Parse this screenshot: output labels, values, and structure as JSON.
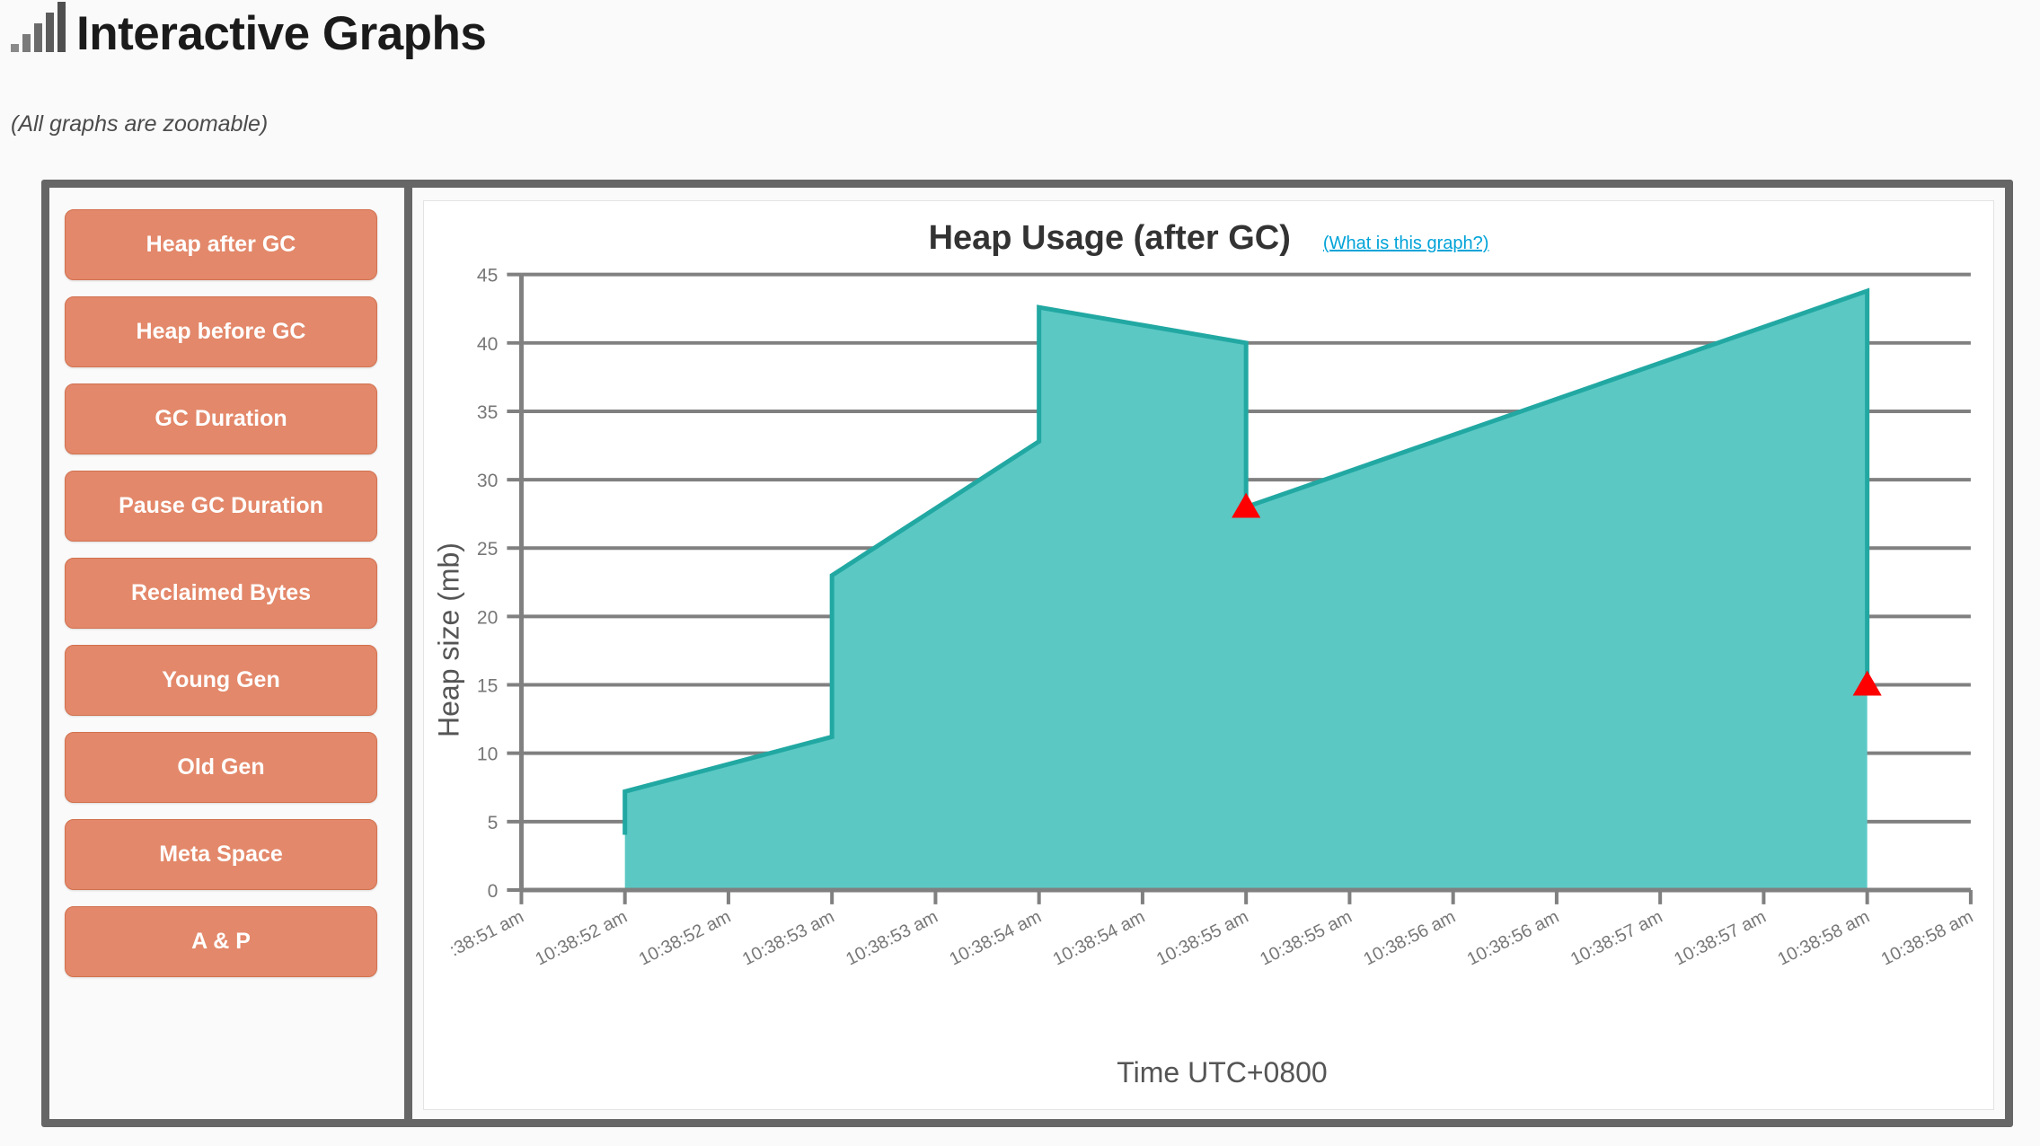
{
  "header": {
    "title": "Interactive Graphs",
    "subtitle": "(All graphs are zoomable)",
    "icon": "bar-chart-icon"
  },
  "sidebar": {
    "items": [
      {
        "label": "Heap after GC"
      },
      {
        "label": "Heap before GC"
      },
      {
        "label": "GC Duration"
      },
      {
        "label": "Pause GC Duration"
      },
      {
        "label": "Reclaimed Bytes"
      },
      {
        "label": "Young Gen"
      },
      {
        "label": "Old Gen"
      },
      {
        "label": "Meta Space"
      },
      {
        "label": "A & P"
      }
    ]
  },
  "chart_panel": {
    "title": "Heap Usage (after GC)",
    "help_link": "(What is this graph?)"
  },
  "colors": {
    "accent_button": "#e3886a",
    "button_border": "#d2714f",
    "area_fill": "#5bc8c4",
    "area_stroke": "#22a8a2",
    "marker": "#ff0000",
    "grid": "#808080",
    "frame_border": "#666666",
    "link": "#00a3d8"
  },
  "chart_data": {
    "type": "area",
    "title": "Heap Usage (after GC)",
    "xlabel": "Time UTC+0800",
    "ylabel": "Heap size (mb)",
    "ylim": [
      0,
      45
    ],
    "yticks": [
      0,
      5,
      10,
      15,
      20,
      25,
      30,
      35,
      40,
      45
    ],
    "grid": true,
    "legend": "none",
    "xticks": [
      ":38:51 am",
      "10:38:52 am",
      "10:38:52 am",
      "10:38:53 am",
      "10:38:53 am",
      "10:38:54 am",
      "10:38:54 am",
      "10:38:55 am",
      "10:38:55 am",
      "10:38:56 am",
      "10:38:56 am",
      "10:38:57 am",
      "10:38:57 am",
      "10:38:58 am",
      "10:38:58 am"
    ],
    "series": [
      {
        "name": "Heap after GC",
        "unit": "mb",
        "points": [
          {
            "x": 1.0,
            "y": 4.2,
            "label": "10:38:52 am"
          },
          {
            "x": 1.0,
            "y": 7.2,
            "label": "10:38:52 am"
          },
          {
            "x": 3.0,
            "y": 11.2,
            "label": "10:38:53 am"
          },
          {
            "x": 3.0,
            "y": 23.0,
            "label": "10:38:53 am"
          },
          {
            "x": 5.0,
            "y": 32.8,
            "label": "10:38:54 am"
          },
          {
            "x": 5.0,
            "y": 42.6,
            "label": "10:38:54 am"
          },
          {
            "x": 7.0,
            "y": 40.0,
            "label": "10:38:55 am"
          },
          {
            "x": 7.0,
            "y": 28.0,
            "label": "10:38:55 am"
          },
          {
            "x": 13.0,
            "y": 43.8,
            "label": "10:38:58 am"
          },
          {
            "x": 13.0,
            "y": 15.0,
            "label": "10:38:58 am"
          }
        ]
      }
    ],
    "markers": [
      {
        "x": 7.0,
        "y": 28.0,
        "shape": "triangle-up",
        "color": "#ff0000"
      },
      {
        "x": 13.0,
        "y": 15.0,
        "shape": "triangle-up",
        "color": "#ff0000"
      }
    ]
  }
}
